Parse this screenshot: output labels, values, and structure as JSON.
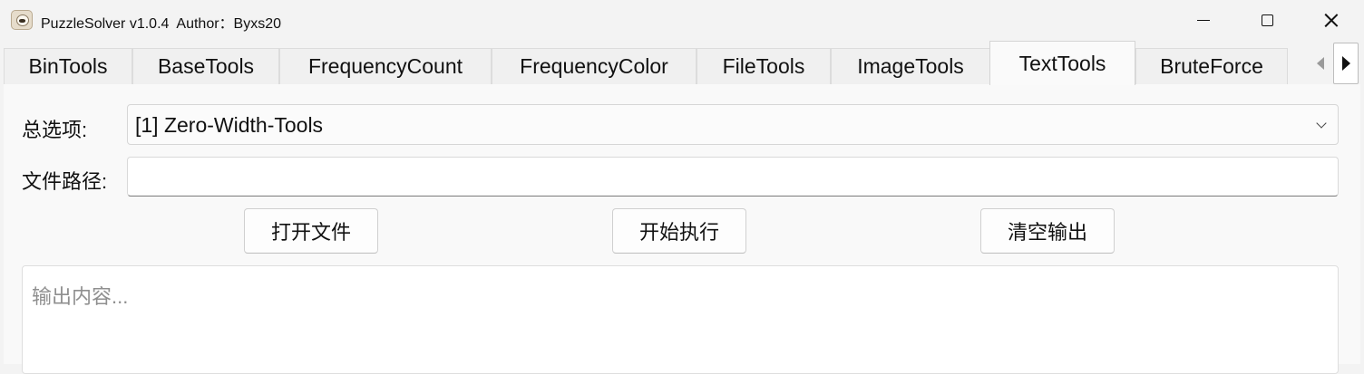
{
  "window": {
    "title": "PuzzleSolver v1.0.4  Author：Byxs20"
  },
  "tabs": [
    {
      "label": "BinTools"
    },
    {
      "label": "BaseTools"
    },
    {
      "label": "FrequencyCount"
    },
    {
      "label": "FrequencyColor"
    },
    {
      "label": "FileTools"
    },
    {
      "label": "ImageTools"
    },
    {
      "label": "TextTools"
    },
    {
      "label": "BruteForce"
    }
  ],
  "active_tab": "TextTools",
  "form": {
    "option_label": "总选项:",
    "option_value": "[1] Zero-Width-Tools",
    "path_label": "文件路径:",
    "path_value": ""
  },
  "buttons": {
    "open_file": "打开文件",
    "execute": "开始执行",
    "clear_output": "清空输出"
  },
  "output": {
    "placeholder": "输出内容..."
  }
}
